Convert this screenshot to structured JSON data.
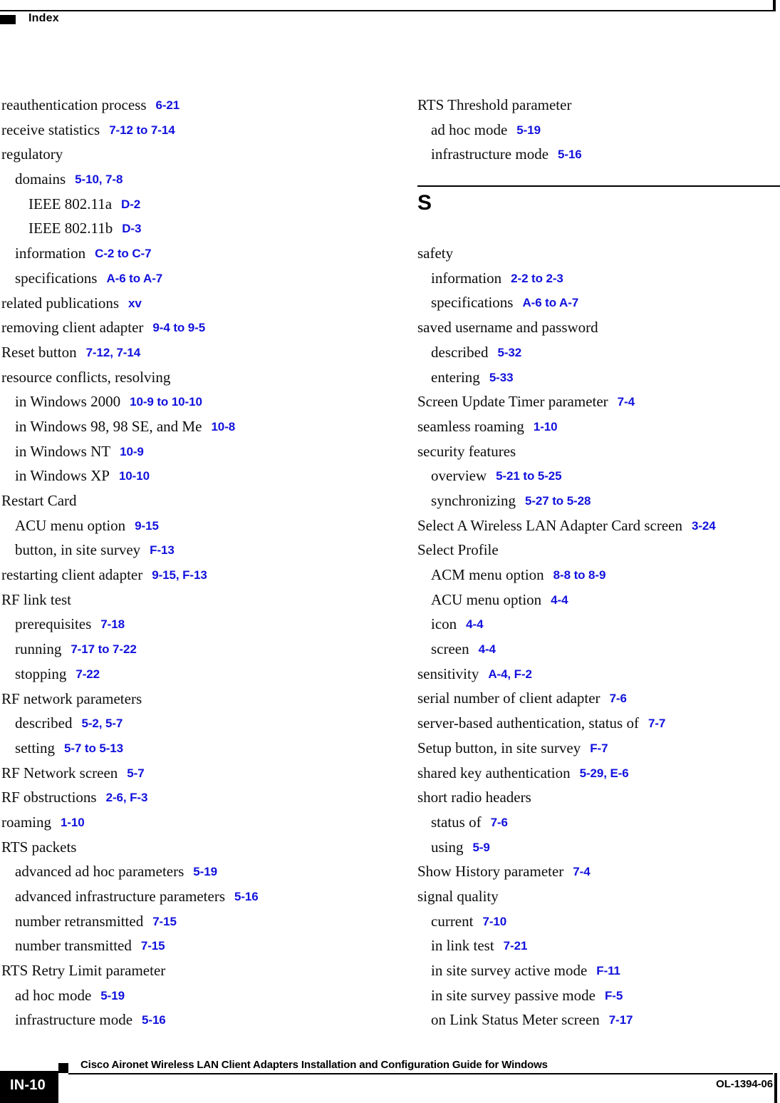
{
  "header": {
    "title": "Index",
    "marker_icon": "black-square-marker"
  },
  "colors": {
    "reference_blue": "#1111dd",
    "text_black": "#0d0d0d",
    "rule_black": "#000000"
  },
  "columns": {
    "left": [
      {
        "level": 0,
        "term": "reauthentication process",
        "refs": "6-21"
      },
      {
        "level": 0,
        "term": "receive statistics",
        "refs": "7-12 to 7-14"
      },
      {
        "level": 0,
        "term": "regulatory",
        "refs": ""
      },
      {
        "level": 1,
        "term": "domains",
        "refs": "5-10, 7-8"
      },
      {
        "level": 2,
        "term": "IEEE 802.11a",
        "refs": "D-2"
      },
      {
        "level": 2,
        "term": "IEEE 802.11b",
        "refs": "D-3"
      },
      {
        "level": 1,
        "term": "information",
        "refs": "C-2 to C-7"
      },
      {
        "level": 1,
        "term": "specifications",
        "refs": "A-6 to A-7"
      },
      {
        "level": 0,
        "term": "related publications",
        "refs": "xv"
      },
      {
        "level": 0,
        "term": "removing client adapter",
        "refs": "9-4 to 9-5"
      },
      {
        "level": 0,
        "term": "Reset button",
        "refs": "7-12, 7-14"
      },
      {
        "level": 0,
        "term": "resource conflicts, resolving",
        "refs": ""
      },
      {
        "level": 1,
        "term": "in Windows 2000",
        "refs": "10-9 to 10-10"
      },
      {
        "level": 1,
        "term": "in Windows 98, 98 SE, and Me",
        "refs": "10-8"
      },
      {
        "level": 1,
        "term": "in Windows NT",
        "refs": "10-9"
      },
      {
        "level": 1,
        "term": "in Windows XP",
        "refs": "10-10"
      },
      {
        "level": 0,
        "term": "Restart Card",
        "refs": ""
      },
      {
        "level": 1,
        "term": "ACU menu option",
        "refs": "9-15"
      },
      {
        "level": 1,
        "term": "button, in site survey",
        "refs": "F-13"
      },
      {
        "level": 0,
        "term": "restarting client adapter",
        "refs": "9-15, F-13"
      },
      {
        "level": 0,
        "term": "RF link test",
        "refs": ""
      },
      {
        "level": 1,
        "term": "prerequisites",
        "refs": "7-18"
      },
      {
        "level": 1,
        "term": "running",
        "refs": "7-17 to 7-22"
      },
      {
        "level": 1,
        "term": "stopping",
        "refs": "7-22"
      },
      {
        "level": 0,
        "term": "RF network parameters",
        "refs": ""
      },
      {
        "level": 1,
        "term": "described",
        "refs": "5-2, 5-7"
      },
      {
        "level": 1,
        "term": "setting",
        "refs": "5-7 to 5-13"
      },
      {
        "level": 0,
        "term": "RF Network screen",
        "refs": "5-7"
      },
      {
        "level": 0,
        "term": "RF obstructions",
        "refs": "2-6, F-3"
      },
      {
        "level": 0,
        "term": "roaming",
        "refs": "1-10"
      },
      {
        "level": 0,
        "term": "RTS packets",
        "refs": ""
      },
      {
        "level": 1,
        "term": "advanced ad hoc parameters",
        "refs": "5-19"
      },
      {
        "level": 1,
        "term": "advanced infrastructure parameters",
        "refs": "5-16"
      },
      {
        "level": 1,
        "term": "number retransmitted",
        "refs": "7-15"
      },
      {
        "level": 1,
        "term": "number transmitted",
        "refs": "7-15"
      },
      {
        "level": 0,
        "term": "RTS Retry Limit parameter",
        "refs": ""
      },
      {
        "level": 1,
        "term": "ad hoc mode",
        "refs": "5-19"
      },
      {
        "level": 1,
        "term": "infrastructure mode",
        "refs": "5-16"
      }
    ],
    "right_before_section": [
      {
        "level": 0,
        "term": "RTS Threshold parameter",
        "refs": ""
      },
      {
        "level": 1,
        "term": "ad hoc mode",
        "refs": "5-19"
      },
      {
        "level": 1,
        "term": "infrastructure mode",
        "refs": "5-16"
      }
    ],
    "right_section_letter": "S",
    "right_after_section": [
      {
        "level": 0,
        "term": "safety",
        "refs": ""
      },
      {
        "level": 1,
        "term": "information",
        "refs": "2-2 to 2-3"
      },
      {
        "level": 1,
        "term": "specifications",
        "refs": "A-6 to A-7"
      },
      {
        "level": 0,
        "term": "saved username and password",
        "refs": ""
      },
      {
        "level": 1,
        "term": "described",
        "refs": "5-32"
      },
      {
        "level": 1,
        "term": "entering",
        "refs": "5-33"
      },
      {
        "level": 0,
        "term": "Screen Update Timer parameter",
        "refs": "7-4"
      },
      {
        "level": 0,
        "term": "seamless roaming",
        "refs": "1-10"
      },
      {
        "level": 0,
        "term": "security features",
        "refs": ""
      },
      {
        "level": 1,
        "term": "overview",
        "refs": "5-21 to 5-25"
      },
      {
        "level": 1,
        "term": "synchronizing",
        "refs": "5-27 to 5-28"
      },
      {
        "level": 0,
        "term": "Select A Wireless LAN Adapter Card screen",
        "refs": "3-24"
      },
      {
        "level": 0,
        "term": "Select Profile",
        "refs": ""
      },
      {
        "level": 1,
        "term": "ACM menu option",
        "refs": "8-8 to 8-9"
      },
      {
        "level": 1,
        "term": "ACU menu option",
        "refs": "4-4"
      },
      {
        "level": 1,
        "term": "icon",
        "refs": "4-4"
      },
      {
        "level": 1,
        "term": "screen",
        "refs": "4-4"
      },
      {
        "level": 0,
        "term": "sensitivity",
        "refs": "A-4, F-2"
      },
      {
        "level": 0,
        "term": "serial number of client adapter",
        "refs": "7-6"
      },
      {
        "level": 0,
        "term": "server-based authentication, status of",
        "refs": "7-7"
      },
      {
        "level": 0,
        "term": "Setup button, in site survey",
        "refs": "F-7"
      },
      {
        "level": 0,
        "term": "shared key authentication",
        "refs": "5-29, E-6"
      },
      {
        "level": 0,
        "term": "short radio headers",
        "refs": ""
      },
      {
        "level": 1,
        "term": "status of",
        "refs": "7-6"
      },
      {
        "level": 1,
        "term": "using",
        "refs": "5-9"
      },
      {
        "level": 0,
        "term": "Show History parameter",
        "refs": "7-4"
      },
      {
        "level": 0,
        "term": "signal quality",
        "refs": ""
      },
      {
        "level": 1,
        "term": "current",
        "refs": "7-10"
      },
      {
        "level": 1,
        "term": "in link test",
        "refs": "7-21"
      },
      {
        "level": 1,
        "term": "in site survey active mode",
        "refs": "F-11"
      },
      {
        "level": 1,
        "term": "in site survey passive mode",
        "refs": "F-5"
      },
      {
        "level": 1,
        "term": "on Link Status Meter screen",
        "refs": "7-17"
      }
    ]
  },
  "footer": {
    "page_number": "IN-10",
    "guide_title": "Cisco Aironet Wireless LAN Client Adapters Installation and Configuration Guide for Windows",
    "doc_id": "OL-1394-06",
    "marker_icon": "black-square-marker"
  }
}
